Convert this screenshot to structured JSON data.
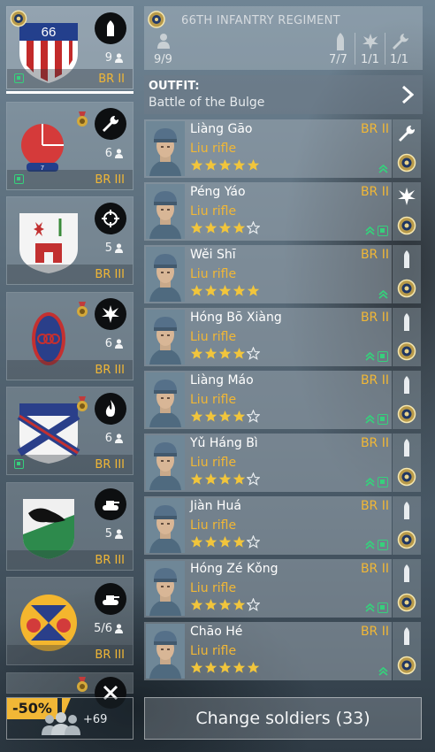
{
  "colors": {
    "gold": "#f1b736",
    "green": "#36d07c"
  },
  "squads": [
    {
      "spec_icon": "bullet-icon",
      "count": "9",
      "br": "BR II",
      "selected": true,
      "premium": true,
      "medal": false
    },
    {
      "spec_icon": "wrench-icon",
      "count": "6",
      "br": "BR III",
      "selected": false,
      "premium": true,
      "medal": true
    },
    {
      "spec_icon": "crosshair-icon",
      "count": "5",
      "br": "BR III",
      "selected": false,
      "premium": false,
      "medal": false
    },
    {
      "spec_icon": "explosion-icon",
      "count": "6",
      "br": "BR III",
      "selected": false,
      "premium": false,
      "medal": true
    },
    {
      "spec_icon": "flame-icon",
      "count": "6",
      "br": "BR III",
      "selected": false,
      "premium": true,
      "medal": true
    },
    {
      "spec_icon": "tank-icon",
      "count": "5",
      "br": "BR III",
      "selected": false,
      "premium": false,
      "medal": false
    },
    {
      "spec_icon": "tank-icon",
      "count": "5/6",
      "br": "BR III",
      "selected": false,
      "premium": false,
      "medal": false
    }
  ],
  "regiment": {
    "title": "66TH INFANTRY REGIMENT",
    "soldiers": "9/9",
    "riflemen": "7/7",
    "assault": "1/1",
    "engineer": "1/1"
  },
  "outfit": {
    "label": "OUTFIT:",
    "value": "Battle of the Bulge"
  },
  "soldiers": [
    {
      "name": "Liàng Gāo",
      "weapon": "Liu rifle",
      "rank": "BR II",
      "stars": 5,
      "chev": true,
      "sq": false,
      "class_icon": "wrench-icon"
    },
    {
      "name": "Péng Yáo",
      "weapon": "Liu rifle",
      "rank": "BR II",
      "stars": 4,
      "chev": true,
      "sq": true,
      "class_icon": "explosion-icon"
    },
    {
      "name": "Wěi Shī",
      "weapon": "Liu rifle",
      "rank": "BR II",
      "stars": 5,
      "chev": true,
      "sq": false,
      "class_icon": "bullet-icon"
    },
    {
      "name": "Hóng Bō Xiàng",
      "weapon": "Liu rifle",
      "rank": "BR II",
      "stars": 4,
      "chev": true,
      "sq": true,
      "class_icon": "bullet-icon"
    },
    {
      "name": "Liàng Máo",
      "weapon": "Liu rifle",
      "rank": "BR II",
      "stars": 4,
      "chev": true,
      "sq": true,
      "class_icon": "bullet-icon"
    },
    {
      "name": "Yǔ Háng Bì",
      "weapon": "Liu rifle",
      "rank": "BR II",
      "stars": 4,
      "chev": true,
      "sq": true,
      "class_icon": "bullet-icon"
    },
    {
      "name": "Jiàn Huá",
      "weapon": "Liu rifle",
      "rank": "BR II",
      "stars": 4,
      "chev": true,
      "sq": true,
      "class_icon": "bullet-icon"
    },
    {
      "name": "Hóng Zé Kǒng",
      "weapon": "Liu rifle",
      "rank": "BR II",
      "stars": 4,
      "chev": true,
      "sq": true,
      "class_icon": "bullet-icon"
    },
    {
      "name": "Chāo Hé",
      "weapon": "Liu rifle",
      "rank": "BR II",
      "stars": 5,
      "chev": true,
      "sq": false,
      "class_icon": "bullet-icon"
    }
  ],
  "buy": {
    "discount": "-50%",
    "extra": "+69"
  },
  "change_button": "Change soldiers (33)"
}
